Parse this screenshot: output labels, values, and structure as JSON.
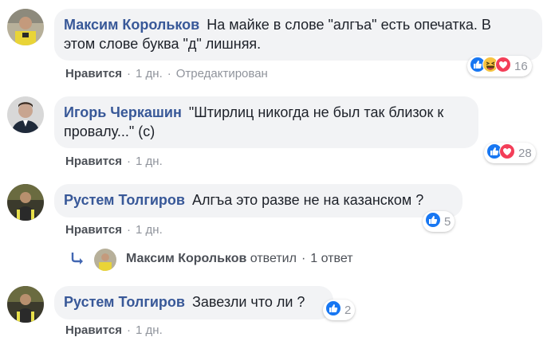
{
  "comments": [
    {
      "author": "Максим Корольков",
      "text_line1": "На майке в слове \"алгъа\" есть опечатка. В",
      "text_line2": "этом слове буква \"д\" лишняя.",
      "like": "Нравится",
      "time": "1 дн.",
      "edited": "Отредактирован",
      "reactions": [
        "like-icon",
        "haha-icon",
        "love-icon"
      ],
      "reaction_count": "16"
    },
    {
      "author": "Игорь Черкашин",
      "text_line1": "\"Штирлиц никогда не был так близок к",
      "text_line2": "провалу...\" (с)",
      "like": "Нравится",
      "time": "1 дн.",
      "reactions": [
        "like-icon",
        "love-icon"
      ],
      "reaction_count": "28"
    },
    {
      "author": "Рустем Толгиров",
      "text": "Алгъа это разве не на казанском ?",
      "like": "Нравится",
      "time": "1 дн.",
      "reactions": [
        "like-icon"
      ],
      "reaction_count": "5"
    },
    {
      "author": "Рустем Толгиров",
      "text": "Завезли что ли ?",
      "like": "Нравится",
      "time": "1 дн.",
      "reactions": [
        "like-icon"
      ],
      "reaction_count": "2"
    }
  ],
  "reply_summary": {
    "author": "Максим Корольков",
    "action": "ответил",
    "count": "1 ответ"
  },
  "colors": {
    "link": "#385898",
    "meta": "#90949c",
    "bubble": "#f2f3f5",
    "like_blue": "#1877f2",
    "love_red": "#f33e58",
    "haha_yellow": "#f7c340"
  }
}
